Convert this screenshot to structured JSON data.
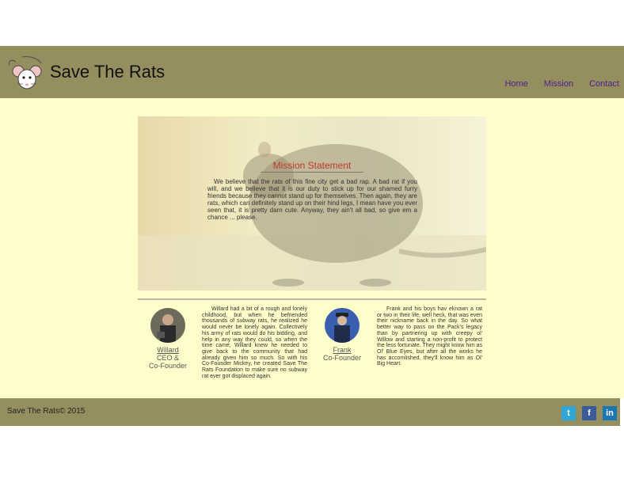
{
  "header": {
    "title": "Save The Rats",
    "nav": [
      "Home",
      "Mission",
      "Contact"
    ]
  },
  "hero": {
    "title": "Mission Statement",
    "text": "We believe that the rats of this fine city get a bad rap. A bad rat if you will, and we believe that it is our duty to stick up for our shamed furry friends because they cannot stand up for themselves. Then again, they are rats, which can definitely stand up on their hind legs, I mean have you ever seen that, it is pretty darn cute. Anyway, they ain't all bad, so give em a chance ... please."
  },
  "people": [
    {
      "name": "Willard",
      "role_line1": "CEO &",
      "role_line2": "Co-Founder",
      "bio": "Willard had a bit of a rough and lonely childhood, but when he befriended thousands of subway rats, he realized he would never be lonely again. Collectively his army of rats would do his bidding, and help in any way they could, so when the time came, Willard knew he needed to give back to the community that had already given him so much. So with his Co-Founder Mickey, he created Save The Rats Foundation to make sure no subway rat ever got displaced again."
    },
    {
      "name": "Frank",
      "role_line1": "Co-Founder",
      "bio": "Frank and his boys hav eknown a rat or two in their life, well heck, that was even their nickname back in the day. So what better way to pass on the Pack's legacy than by partnering up with creepy ol' Willow and starting a non-profit to protect the less fortunate. They might know him as Ol' Blue Eyes, but after all the works he has accomlished, they'll know him as Ol' Big Heart."
    }
  ],
  "footer": {
    "copyright": "Save The Rats© 2015",
    "social": [
      {
        "icon": "twitter-icon",
        "glyph": "t",
        "color": "#2ea6d8"
      },
      {
        "icon": "facebook-icon",
        "glyph": "f",
        "color": "#3b5a9a"
      },
      {
        "icon": "linkedin-icon",
        "glyph": "in",
        "color": "#1a75b3"
      }
    ]
  },
  "colors": {
    "bar": "#958f5f",
    "background": "#ffffcc",
    "nav_link": "#4b1f8c",
    "mission_title": "#c0392b"
  }
}
